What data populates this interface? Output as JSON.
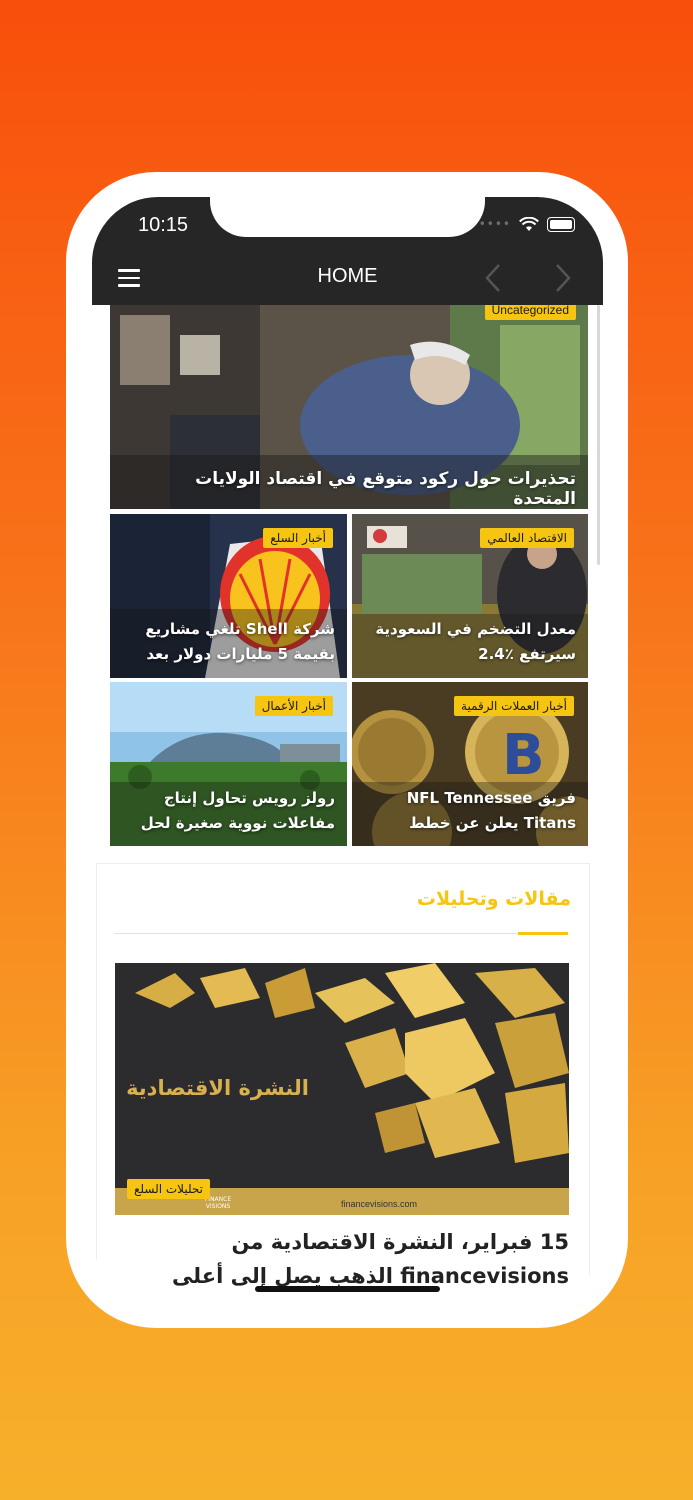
{
  "status_bar": {
    "time": "10:15"
  },
  "header": {
    "title": "HOME"
  },
  "featured": {
    "category": "Uncategorized",
    "title": "تحذيرات حول ركود متوقع في اقتصاد الولايات المتحدة"
  },
  "grid": [
    {
      "category": "الاقتصاد العالمي",
      "title": "معدل التضخم في السعودية سيرتفع ٪2.4"
    },
    {
      "category": "أخبار السلع",
      "title": "شركة Shell تلغي مشاريع بقيمة 5 مليارات دولار بعد"
    },
    {
      "category": "أخبار العملات الرقمية",
      "title": "فريق NFL Tennessee Titans يعلن عن خطط"
    },
    {
      "category": "أخبار الأعمال",
      "title": "رولز رويس تحاول إنتاج مفاعلات نووية صغيرة لحل"
    }
  ],
  "section": {
    "title": "مقالات وتحليلات",
    "article": {
      "image_text": "النشرة الاقتصادية",
      "image_footer_site": "financevisions.com",
      "image_logo_text": "FINANCE VISIONS",
      "category": "تحليلات السلع",
      "title": "15 فبراير، النشرة الاقتصادية من financevisions الذهب يصل إلى أعلى"
    }
  },
  "colors": {
    "accent": "#f6c512",
    "appbar": "#262626",
    "bg_top": "#f84f0c",
    "bg_bottom": "#f7b02a"
  }
}
